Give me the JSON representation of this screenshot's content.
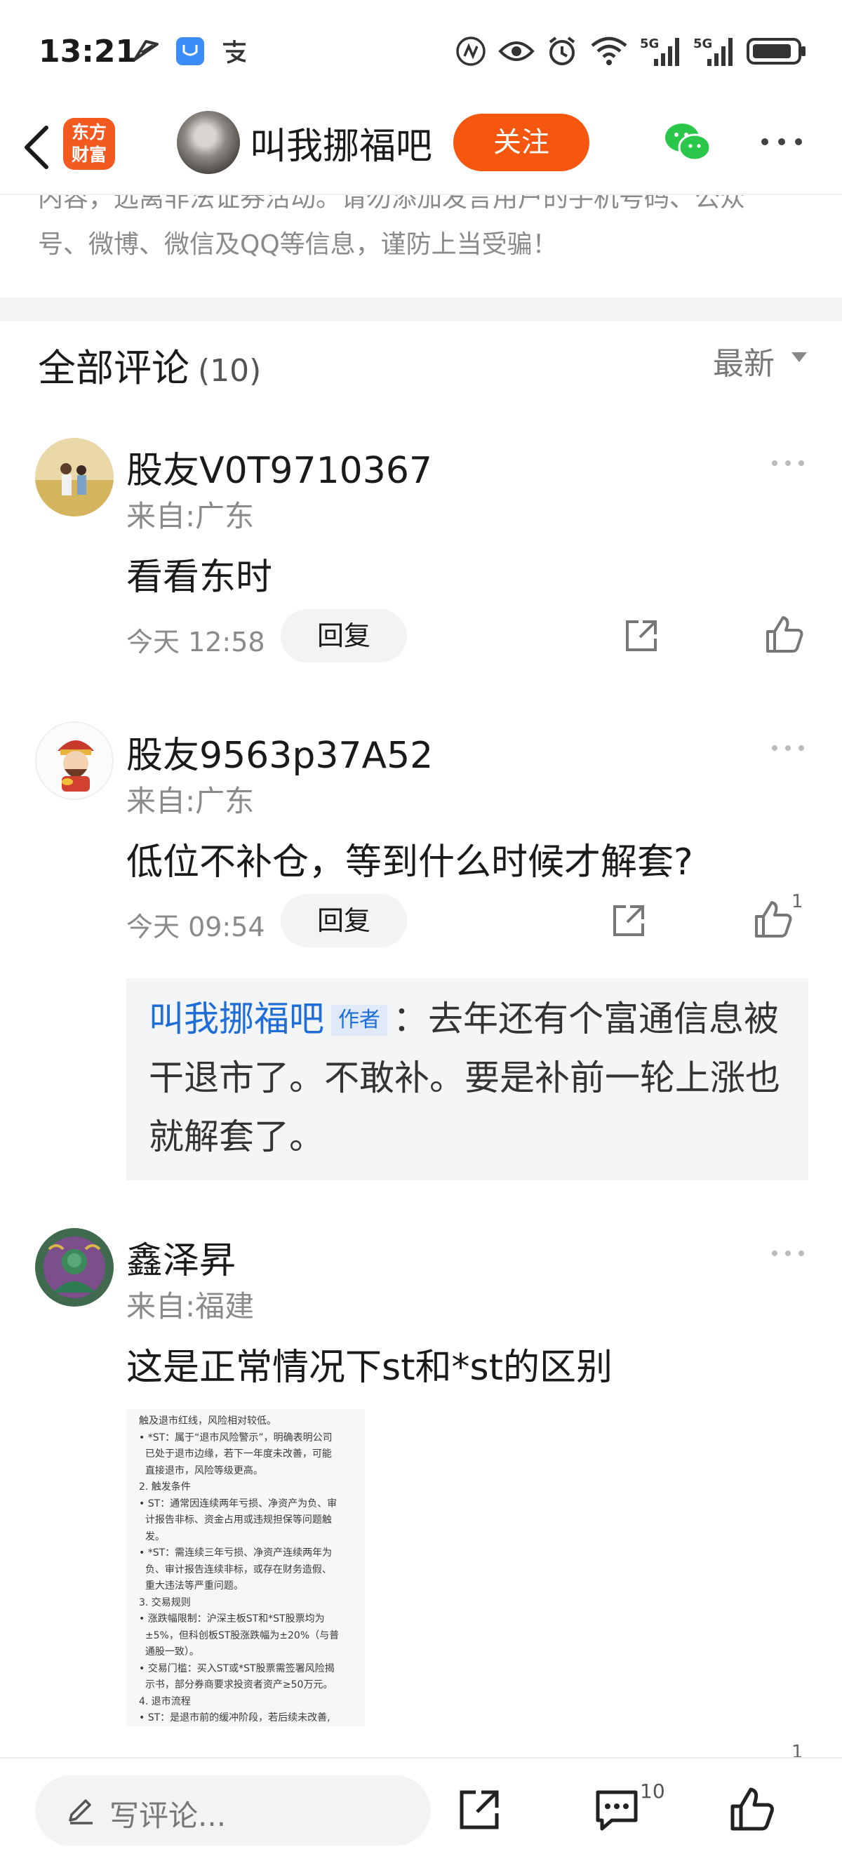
{
  "status_bar": {
    "time": "13:21",
    "left_icons": [
      "send-icon",
      "honor-app-icon",
      "alipay-icon"
    ],
    "right_icons": [
      "nfc-icon",
      "eye-icon",
      "alarm-icon",
      "wifi-icon",
      "signal-5g-icon",
      "signal-5g-icon",
      "battery-icon"
    ],
    "signal_label_1": "5G",
    "signal_label_2": "5G"
  },
  "topnav": {
    "logo_text_line1": "东方",
    "logo_text_line2": "财富",
    "username": "叫我挪福吧",
    "follow_label": "关注"
  },
  "notice": {
    "line1": "内容，远离非法证券活动。请勿添加发言用户的手机号码、公众",
    "line2": "号、微博、微信及QQ等信息，谨防上当受骗！"
  },
  "comments_header": {
    "title": "全部评论",
    "count": "(10)",
    "sort": "最新"
  },
  "comments": [
    {
      "name": "股友V0T9710367",
      "location": "来自:广东",
      "text": "看看东时",
      "time": "今天 12:58",
      "reply_label": "回复",
      "likes": ""
    },
    {
      "name": "股友9563p37A52",
      "location": "来自:广东",
      "text": "低位不补仓，等到什么时候才解套?",
      "time": "今天 09:54",
      "reply_label": "回复",
      "likes": "1",
      "reply": {
        "author": "叫我挪福吧",
        "tag": "作者",
        "text": "：去年还有个富通信息被干退市了。不敢补。要是补前一轮上涨也就解套了。"
      }
    },
    {
      "name": "鑫泽昇",
      "location": "来自:福建",
      "text": "这是正常情况下st和*st的区别",
      "likes": "1",
      "image_lines": [
        "触及退市红线，风险相对较低。",
        "• *ST：属于“退市风险警示”，明确表明公司",
        "  已处于退市边缘，若下一年度未改善，可能",
        "  直接退市，风险等级更高。",
        "2. 触发条件",
        "• ST：通常因连续两年亏损、净资产为负、审",
        "  计报告非标、资金占用或违规担保等问题触",
        "  发。",
        "• *ST：需连续三年亏损、净资产连续两年为",
        "  负、审计报告连续非标，或存在财务造假、",
        "  重大违法等严重问题。",
        "3. 交易规则",
        "• 涨跌幅限制：沪深主板ST和*ST股票均为",
        "  ±5%，但科创板ST股涨跌幅为±20%（与普",
        "  通股一致）。",
        "• 交易门槛：买入ST或*ST股票需签署风险揭",
        "  示书，部分券商要求投资者资产≥50万元。",
        "4. 退市流程",
        "• ST：是退市前的缓冲阶段，若后续未改善,"
      ]
    }
  ],
  "bottom_bar": {
    "input_placeholder": "写评论...",
    "comment_count": "10"
  },
  "colors": {
    "accent": "#f7560e",
    "link_blue": "#1f6dd6",
    "wechat_green": "#2bc74a"
  }
}
